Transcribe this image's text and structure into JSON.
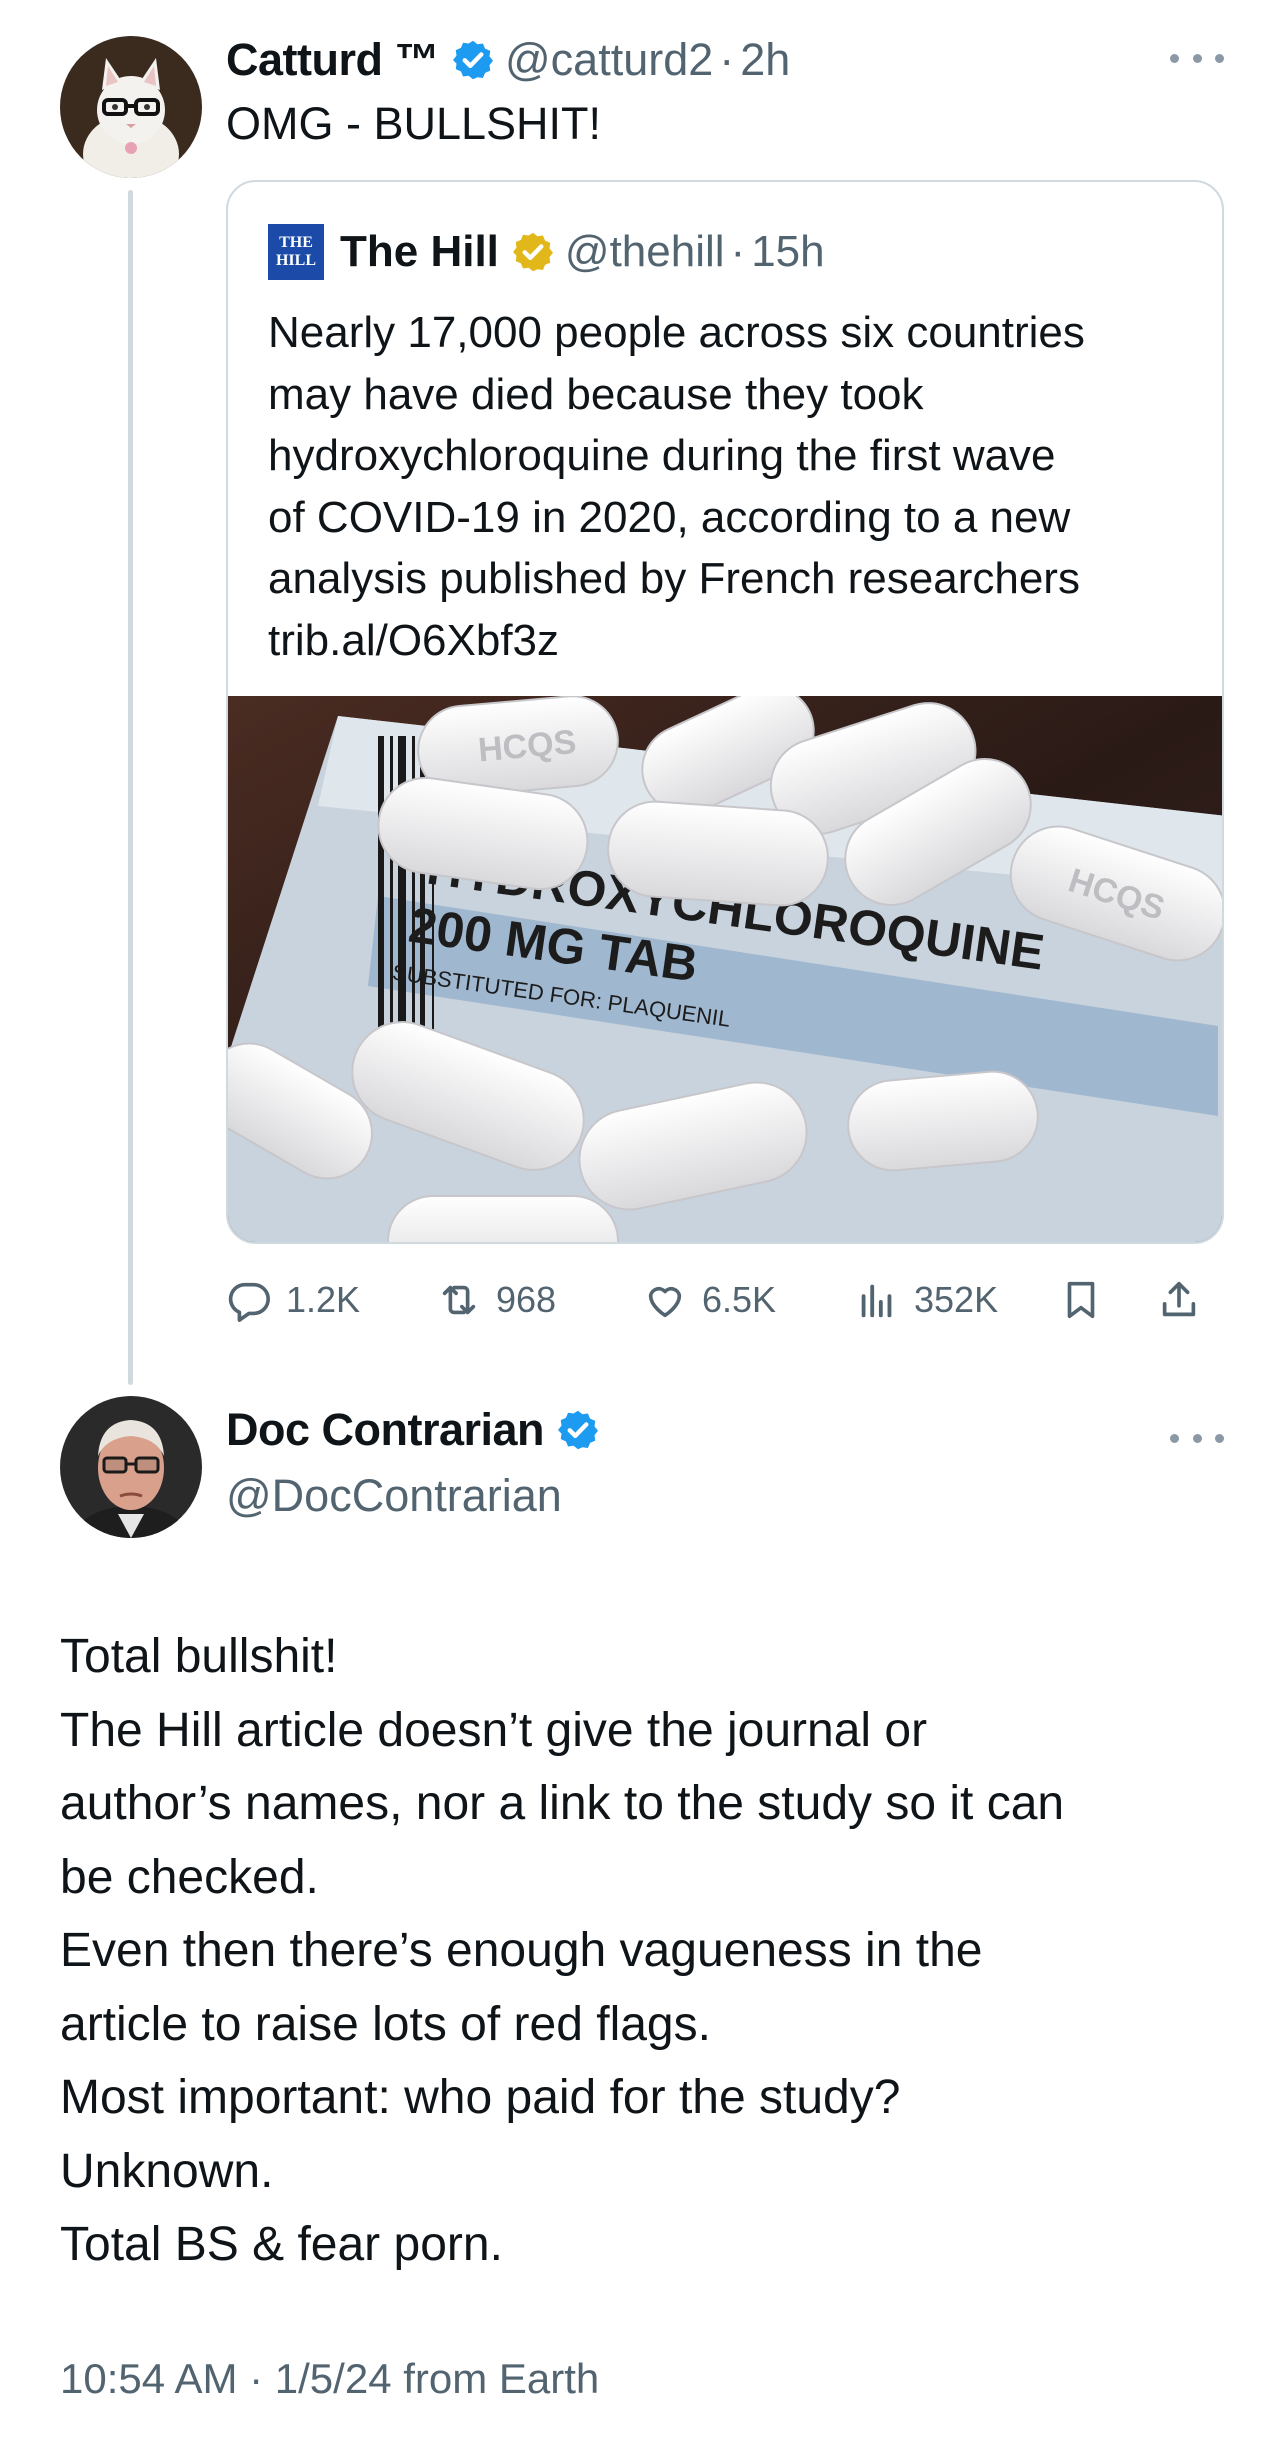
{
  "main_tweet": {
    "author_name": "Catturd ™",
    "author_handle": "@catturd2",
    "separator": "·",
    "time": "2h",
    "text": "OMG - BULLSHIT!",
    "quoted_tweet": {
      "logo_text": "THE HILL",
      "author_name": "The Hill",
      "author_handle": "@thehill",
      "separator": "·",
      "time": "15h",
      "text_lines": [
        "Nearly 17,000 people across six countries",
        "may have died because they took",
        "hydroxychloroquine during the first wave",
        "of COVID-19 in 2020, according to a new",
        "analysis published by French researchers",
        "trib.al/O6Xbf3z"
      ],
      "image_label_lines": [
        "HYDROXYCHLOROQUINE",
        "200 MG TAB",
        "SUBSTITUTED FOR: PLAQUENIL"
      ],
      "pill_imprint": "HCQS"
    },
    "actions": {
      "replies": "1.2K",
      "retweets": "968",
      "likes": "6.5K",
      "views": "352K"
    }
  },
  "reply_tweet": {
    "author_name": "Doc Contrarian",
    "author_handle": "@DocContrarian",
    "text_lines": [
      "Total bullshit!",
      "The Hill article doesn’t give the journal or",
      "author’s names, nor a link to the study so it can",
      "be checked.",
      "Even then there’s enough vagueness in the",
      "article to raise lots of red flags.",
      "Most important: who paid for the study?",
      "Unknown.",
      "Total BS & fear porn."
    ],
    "timestamp": "10:54 AM · 1/5/24 from Earth"
  },
  "colors": {
    "verified_blue": "#1d9bf0",
    "verified_gold": "#e2b719",
    "secondary_text": "#536471",
    "border": "#cfd9de"
  },
  "icons": [
    "more-icon",
    "verified-badge-icon",
    "reply-icon",
    "retweet-icon",
    "like-icon",
    "views-icon",
    "bookmark-icon",
    "share-icon"
  ]
}
